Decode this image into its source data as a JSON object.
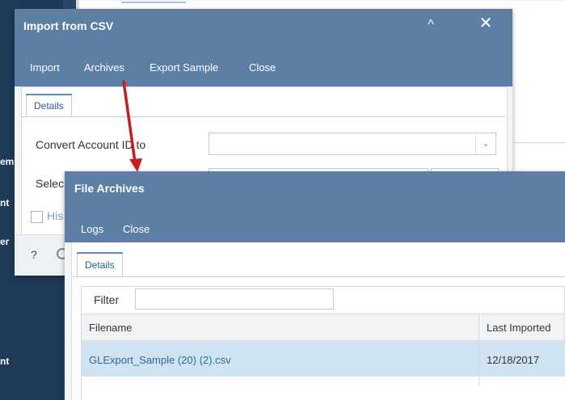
{
  "background": {
    "sidebar_fragments": [
      "em",
      "nt",
      "er",
      "nt"
    ]
  },
  "import_dialog": {
    "title": "Import from CSV",
    "collapse_glyph": "^",
    "close_glyph": "✕",
    "menu": [
      "Import",
      "Archives",
      "Export Sample",
      "Close"
    ],
    "tab": "Details",
    "fields": {
      "convert_label": "Convert Account ID to",
      "convert_value": "",
      "select_label": "Selec",
      "history_label": "His"
    },
    "footer_help": "?"
  },
  "archives_dialog": {
    "title": "File Archives",
    "menu": [
      "Logs",
      "Close"
    ],
    "tab": "Details",
    "filter_label": "Filter",
    "filter_value": "",
    "columns": [
      "Filename",
      "Last Imported"
    ],
    "rows": [
      {
        "filename": "GLExport_Sample (20) (2).csv",
        "last_imported": "12/18/2017"
      }
    ]
  },
  "icons": {
    "dropdown": "chevron-down-icon",
    "close": "close-icon",
    "collapse": "chevron-up-icon",
    "help": "help-icon",
    "globe": "globe-icon"
  },
  "colors": {
    "header": "#5c7fa3",
    "sidebar": "#1e3a58",
    "selected_row": "#cfe3f1",
    "link": "#2b6aa8",
    "annotation_arrow": "#c41e1e"
  }
}
